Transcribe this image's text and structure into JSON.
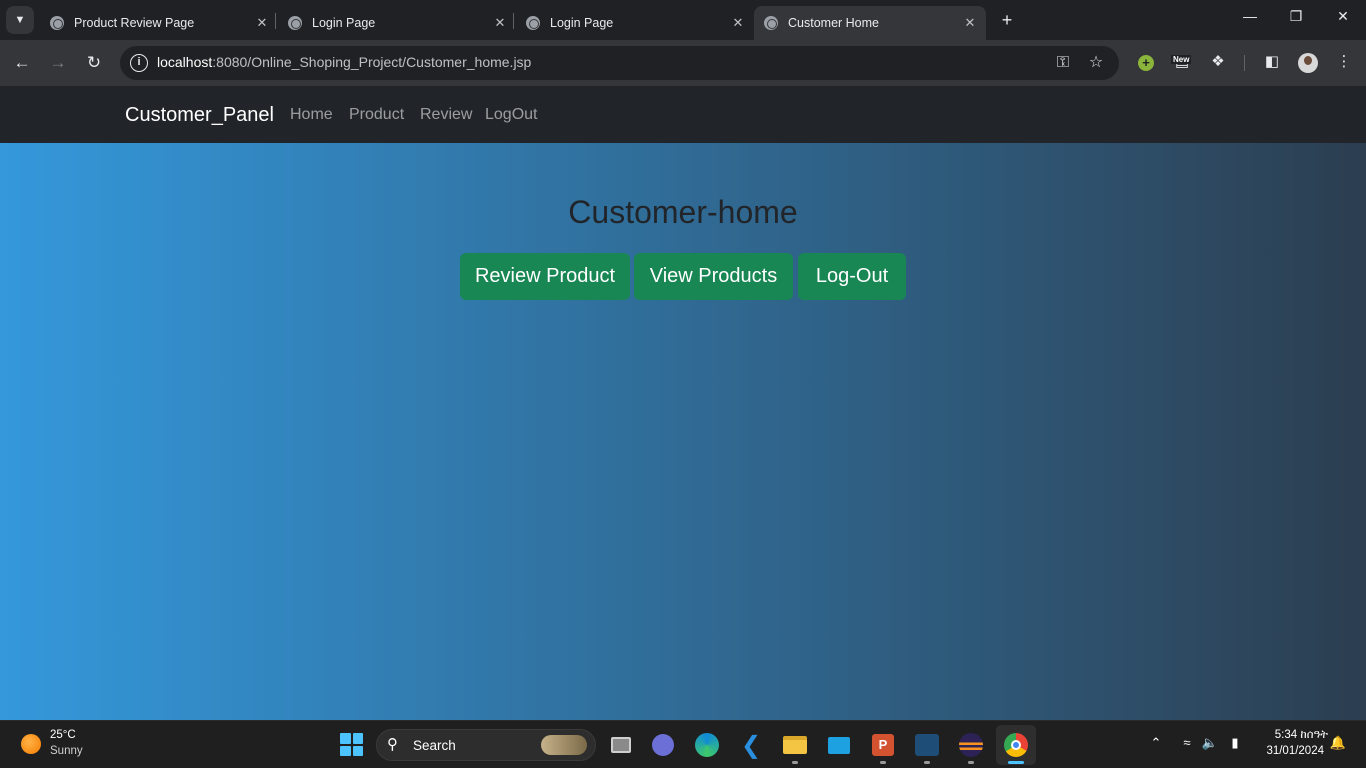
{
  "browser": {
    "tabs": [
      {
        "title": "Product Review Page"
      },
      {
        "title": "Login Page"
      },
      {
        "title": "Login Page"
      },
      {
        "title": "Customer Home",
        "active": true
      }
    ],
    "new_tab_symbol": "+",
    "window_controls": {
      "minimize": "—",
      "restore": "❐",
      "close": "✕"
    },
    "url_host": "localhost",
    "url_rest": ":8080/Online_Shoping_Project/Customer_home.jsp",
    "extension_badge": "New",
    "icons": [
      "tab-search-icon",
      "globe-icon",
      "back-icon",
      "forward-icon",
      "reload-icon",
      "info-icon",
      "key-icon",
      "star-icon",
      "extension-icon",
      "puzzle-icon",
      "side-panel-icon",
      "profile-avatar",
      "menu-icon"
    ]
  },
  "app": {
    "brand": "Customer_Panel",
    "nav_links": [
      "Home",
      "Product",
      "Review",
      "LogOut"
    ],
    "heading": "Customer-home",
    "buttons": [
      "Review Product",
      "View Products",
      "Log-Out"
    ],
    "colors": {
      "navbar": "#212529",
      "gradient_start": "#3498db",
      "gradient_end": "#2c3e50",
      "button": "#198754",
      "heading": "#212529"
    }
  },
  "taskbar": {
    "weather_temp": "25°C",
    "weather_cond": "Sunny",
    "search_label": "Search",
    "apps": [
      "task-view",
      "teams",
      "edge",
      "vscode",
      "file-explorer",
      "remote-desktop",
      "powerpoint",
      "mysql-workbench",
      "eclipse",
      "chrome"
    ],
    "clock_time": "5:34 ከሰዓት",
    "clock_date": "31/01/2024"
  }
}
